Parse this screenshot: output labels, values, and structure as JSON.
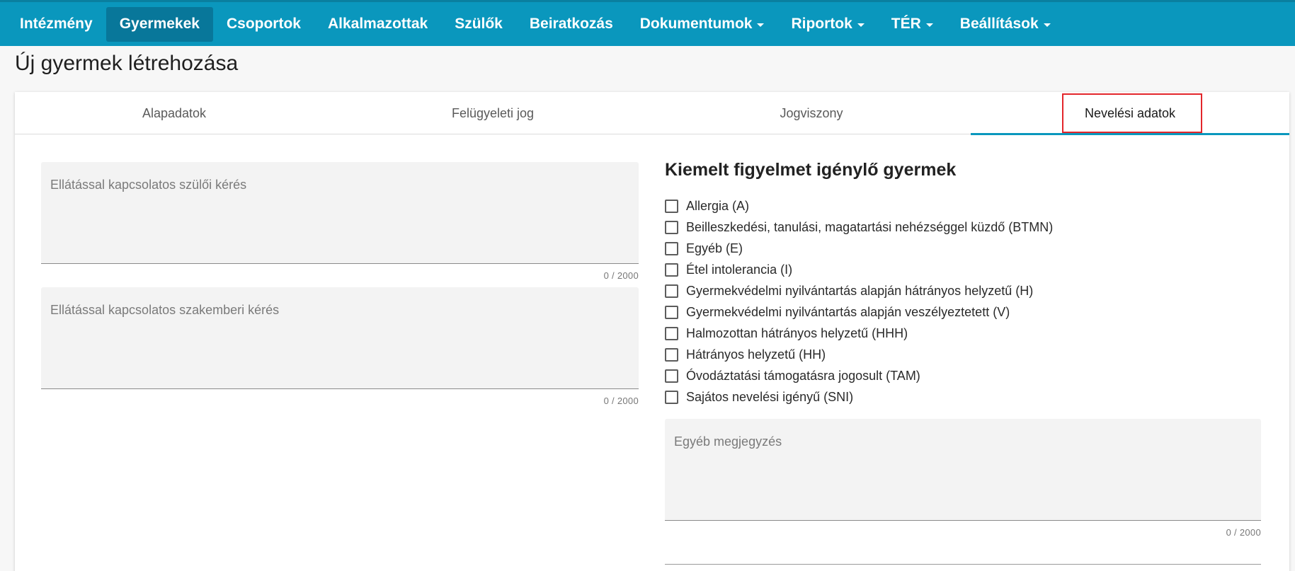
{
  "nav": {
    "items": [
      {
        "label": "Intézmény",
        "dropdown": false,
        "active": false
      },
      {
        "label": "Gyermekek",
        "dropdown": false,
        "active": true
      },
      {
        "label": "Csoportok",
        "dropdown": false,
        "active": false
      },
      {
        "label": "Alkalmazottak",
        "dropdown": false,
        "active": false
      },
      {
        "label": "Szülők",
        "dropdown": false,
        "active": false
      },
      {
        "label": "Beiratkozás",
        "dropdown": false,
        "active": false
      },
      {
        "label": "Dokumentumok",
        "dropdown": true,
        "active": false
      },
      {
        "label": "Riportok",
        "dropdown": true,
        "active": false
      },
      {
        "label": "TÉR",
        "dropdown": true,
        "active": false
      },
      {
        "label": "Beállítások",
        "dropdown": true,
        "active": false
      }
    ]
  },
  "page": {
    "title": "Új gyermek létrehozása"
  },
  "tabs": [
    {
      "label": "Alapadatok",
      "active": false
    },
    {
      "label": "Felügyeleti jog",
      "active": false
    },
    {
      "label": "Jogviszony",
      "active": false
    },
    {
      "label": "Nevelési adatok",
      "active": true
    }
  ],
  "fields": {
    "parent_request": {
      "placeholder": "Ellátással kapcsolatos szülői kérés",
      "value": "",
      "counter": "0 / 2000"
    },
    "specialist_request": {
      "placeholder": "Ellátással kapcsolatos szakemberi kérés",
      "value": "",
      "counter": "0 / 2000"
    },
    "other_note": {
      "placeholder": "Egyéb megjegyzés",
      "value": "",
      "counter": "0 / 2000"
    }
  },
  "special_attention": {
    "title": "Kiemelt figyelmet igénylő gyermek",
    "options": [
      {
        "label": "Allergia (A)",
        "checked": false
      },
      {
        "label": "Beilleszkedési, tanulási, magatartási nehézséggel küzdő (BTMN)",
        "checked": false
      },
      {
        "label": "Egyéb (E)",
        "checked": false
      },
      {
        "label": "Étel intolerancia (I)",
        "checked": false
      },
      {
        "label": "Gyermekvédelmi nyilvántartás alapján hátrányos helyzetű (H)",
        "checked": false
      },
      {
        "label": "Gyermekvédelmi nyilvántartás alapján veszélyeztetett (V)",
        "checked": false
      },
      {
        "label": "Halmozottan hátrányos helyzetű (HHH)",
        "checked": false
      },
      {
        "label": "Hátrányos helyzetű (HH)",
        "checked": false
      },
      {
        "label": "Óvodáztatási támogatásra jogosult (TAM)",
        "checked": false
      },
      {
        "label": "Sajátos nevelési igényű (SNI)",
        "checked": false
      }
    ]
  },
  "colors": {
    "nav_bg": "#0a97bd",
    "nav_active": "#08779a",
    "tab_indicator": "#0a97bd",
    "highlight": "#e3262b"
  }
}
